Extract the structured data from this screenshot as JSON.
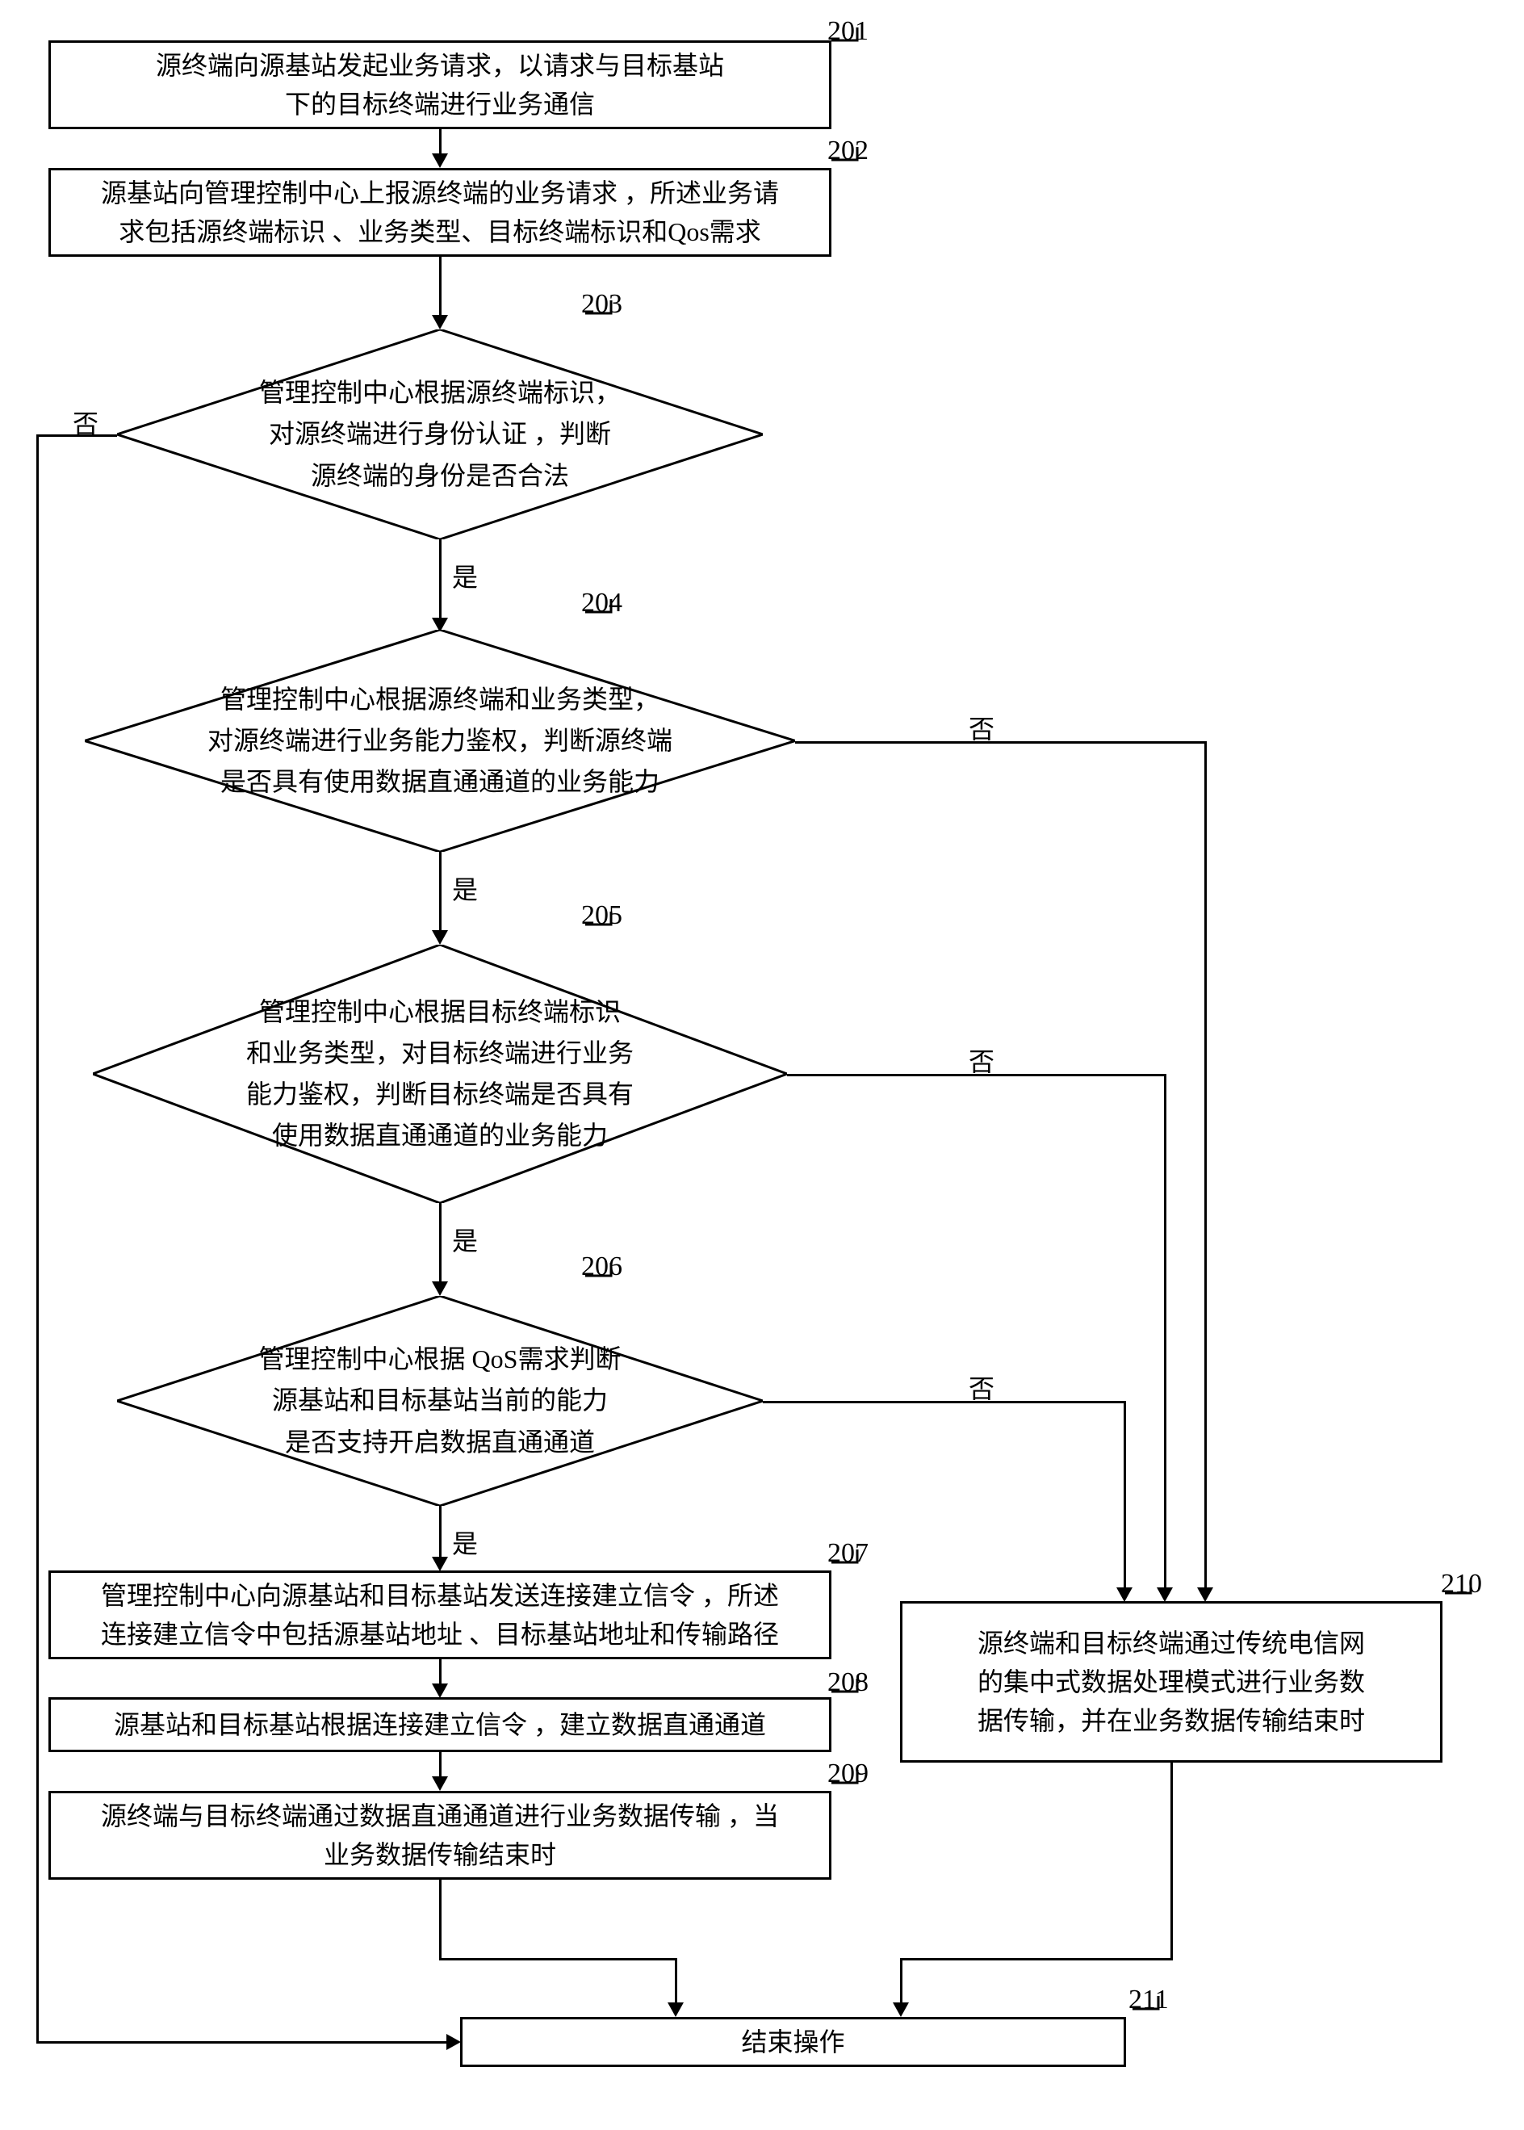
{
  "steps": {
    "s201": {
      "num": "201",
      "text": "源终端向源基站发起业务请求，以请求与目标基站\n下的目标终端进行业务通信"
    },
    "s202": {
      "num": "202",
      "text": "源基站向管理控制中心上报源终端的业务请求 ，所述业务请\n求包括源终端标识 、业务类型、目标终端标识和Qos需求"
    },
    "s203": {
      "num": "203",
      "text": "管理控制中心根据源终端标识，\n对源终端进行身份认证  ，判断\n源终端的身份是否合法"
    },
    "s204": {
      "num": "204",
      "text": "管理控制中心根据源终端和业务类型，\n对源终端进行业务能力鉴权，判断源终端\n是否具有使用数据直通通道的业务能力"
    },
    "s205": {
      "num": "205",
      "text": "管理控制中心根据目标终端标识\n和业务类型，对目标终端进行业务\n能力鉴权，判断目标终端是否具有\n使用数据直通通道的业务能力"
    },
    "s206": {
      "num": "206",
      "text": "管理控制中心根据 QoS需求判断\n源基站和目标基站当前的能力\n是否支持开启数据直通通道"
    },
    "s207": {
      "num": "207",
      "text": "管理控制中心向源基站和目标基站发送连接建立信令  ，所述\n连接建立信令中包括源基站地址 、目标基站地址和传输路径"
    },
    "s208": {
      "num": "208",
      "text": "源基站和目标基站根据连接建立信令  ，建立数据直通通道"
    },
    "s209": {
      "num": "209",
      "text": "源终端与目标终端通过数据直通通道进行业务数据传输  ，当\n业务数据传输结束时"
    },
    "s210": {
      "num": "210",
      "text": "源终端和目标终端通过传统电信网\n的集中式数据处理模式进行业务数\n据传输，并在业务数据传输结束时"
    },
    "s211": {
      "num": "211",
      "text": "结束操作"
    }
  },
  "labels": {
    "yes": "是",
    "no": "否"
  }
}
